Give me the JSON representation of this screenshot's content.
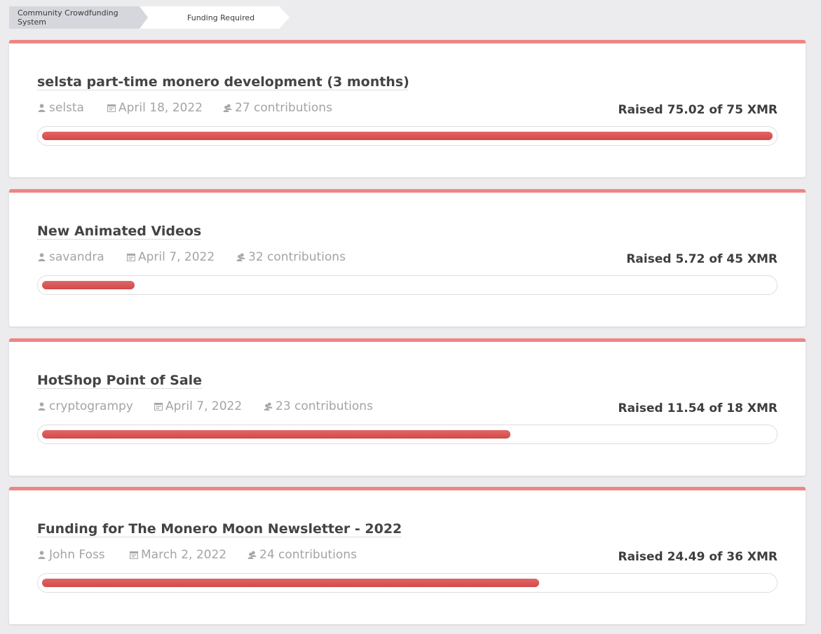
{
  "breadcrumb": {
    "items": [
      "Community Crowdfunding System",
      "Funding Required"
    ]
  },
  "colors": {
    "accent": "#ee8585",
    "progress": "#d94f4f"
  },
  "icons": {
    "author": "user-icon",
    "date": "calendar-icon",
    "contributions": "users-icon"
  },
  "proposals": [
    {
      "title": "selsta part-time monero development (3 months)",
      "author": "selsta",
      "date": "April 18, 2022",
      "contributions": "27 contributions",
      "raised": "Raised 75.02 of 75 XMR",
      "progress": 1.0
    },
    {
      "title": "New Animated Videos",
      "author": "savandra",
      "date": "April 7, 2022",
      "contributions": "32 contributions",
      "raised": "Raised 5.72 of 45 XMR",
      "progress": 0.127
    },
    {
      "title": "HotShop Point of Sale",
      "author": "cryptogrampy",
      "date": "April 7, 2022",
      "contributions": "23 contributions",
      "raised": "Raised 11.54 of 18 XMR",
      "progress": 0.641
    },
    {
      "title": "Funding for The Monero Moon Newsletter - 2022",
      "author": "John Foss",
      "date": "March 2, 2022",
      "contributions": "24 contributions",
      "raised": "Raised 24.49 of 36 XMR",
      "progress": 0.68
    }
  ]
}
